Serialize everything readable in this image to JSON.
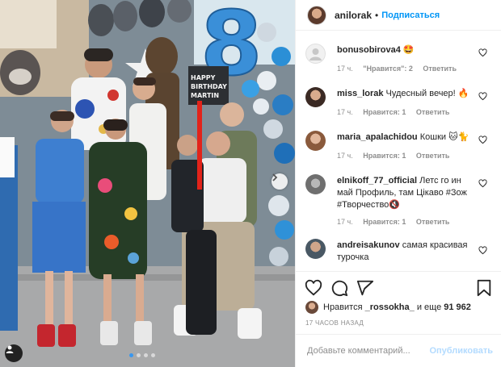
{
  "photo": {
    "balloon_number": "8",
    "sign_lines": [
      "HAPPY",
      "BIRTHDAY",
      "MARTIN"
    ],
    "slides_count": 4,
    "active_slide": 1
  },
  "header": {
    "username": "anilorak",
    "separator": "•",
    "follow_label": "Подписаться"
  },
  "comments": [
    {
      "username": "bonusobirova4",
      "text": "🤩",
      "time": "17 ч.",
      "likes": "\"Нравится\": 2",
      "reply": "Ответить"
    },
    {
      "username": "miss_lorak",
      "text": "Чудесный вечер! 🔥",
      "time": "17 ч.",
      "likes": "Нравится: 1",
      "reply": "Ответить"
    },
    {
      "username": "maria_apalachidou",
      "text": "Кошки 🐱🐈",
      "time": "17 ч.",
      "likes": "Нравится: 1",
      "reply": "Ответить"
    },
    {
      "username": "elnikoff_77_official",
      "text": "Летс го ин май Профиль, там Цікаво",
      "tags": [
        "#Зож",
        "#Творчество"
      ],
      "emoji": "🔇",
      "time": "17 ч.",
      "likes": "Нравится: 1",
      "reply": "Ответить"
    },
    {
      "username": "andreisakunov",
      "text": "самая красивая турочка",
      "time": "",
      "likes": "",
      "reply": ""
    }
  ],
  "likes": {
    "prefix": "Нравится",
    "user": "_rossokha_",
    "middle": "и еще",
    "count": "91 962"
  },
  "date": "17 ЧАСОВ НАЗАД",
  "add_comment": {
    "placeholder": "Добавьте комментарий...",
    "publish_label": "Опубликовать"
  },
  "colors": {
    "link": "#0095f6",
    "publish_disabled": "#b3dbff",
    "muted": "#8e8e8e",
    "carousel_active": "#3897f0"
  }
}
